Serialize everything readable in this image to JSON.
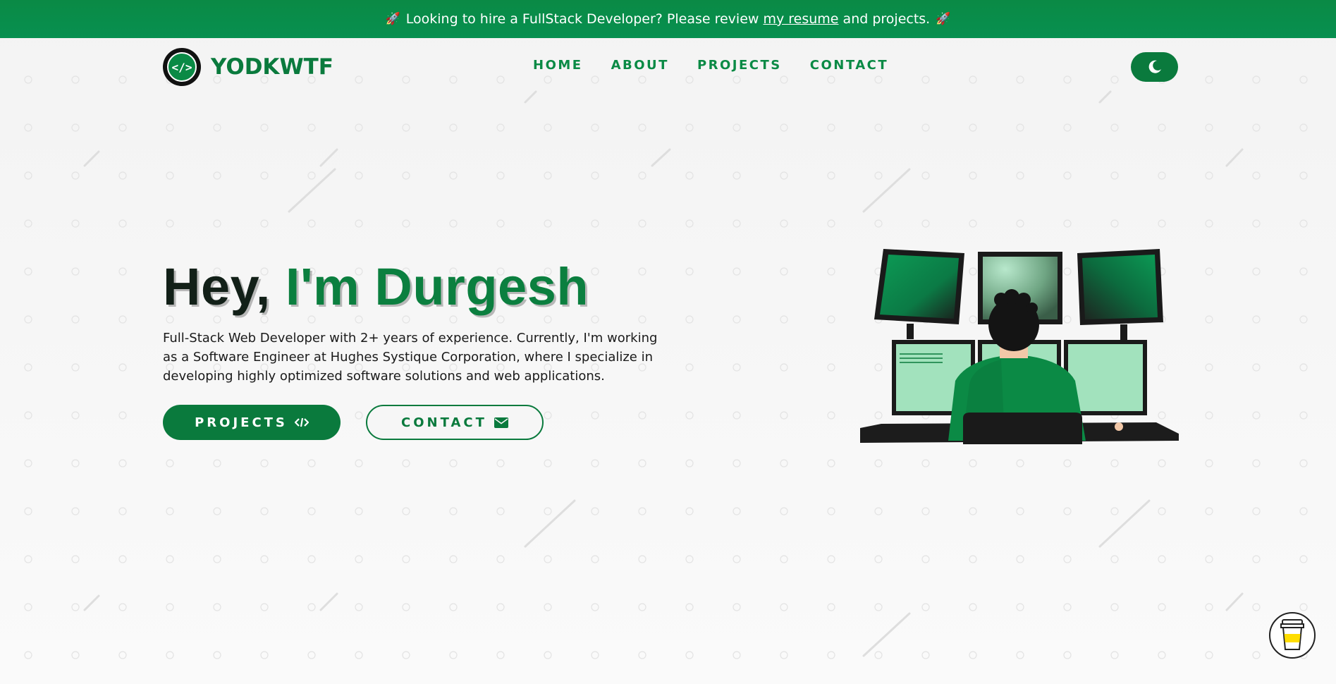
{
  "banner": {
    "rocket_left": "🚀",
    "text_before": "Looking to hire a FullStack Developer? Please review",
    "link_text": "my resume",
    "text_after": "and projects.",
    "rocket_right": "🚀"
  },
  "header": {
    "logo_glyph": "</>",
    "logo_text": "YODKWTF",
    "nav": [
      "HOME",
      "ABOUT",
      "PROJECTS",
      "CONTACT"
    ],
    "theme_icon": "moon-icon"
  },
  "hero": {
    "greeting": "Hey,",
    "name": "I'm Durgesh",
    "description": "Full-Stack Web Developer with 2+ years of experience. Currently, I'm working as a Software Engineer at Hughes Systique Corporation, where I specialize in developing highly optimized software solutions and web applications.",
    "primary_button": "PROJECTS",
    "primary_icon": "code-icon",
    "secondary_button": "CONTACT",
    "secondary_icon": "envelope-icon"
  },
  "floating": {
    "coffee_icon": "coffee-cup-icon"
  },
  "colors": {
    "brand_green": "#0a7a3d",
    "banner_green": "#0a8a45",
    "background": "#f3f3f3"
  }
}
